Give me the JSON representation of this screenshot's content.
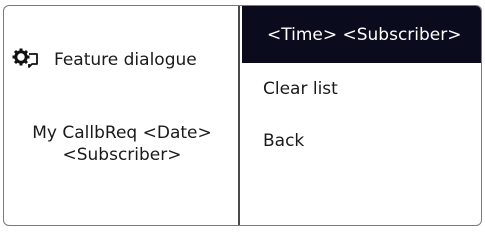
{
  "feature": {
    "label": "Feature dialogue",
    "icon": "feature-dialogue-icon"
  },
  "message": {
    "line1": "My CallbReq <Date>",
    "line2": "<Subscriber>"
  },
  "menu": {
    "items": [
      {
        "label": "<Time> <Subscriber>",
        "selected": true
      },
      {
        "label": "Clear list",
        "selected": false
      },
      {
        "label": "Back",
        "selected": false
      }
    ]
  },
  "colors": {
    "selection_background": "#0b0b1e",
    "selection_text": "#ffffff",
    "border": "#7a7a7a",
    "divider": "#4a4a4a"
  }
}
